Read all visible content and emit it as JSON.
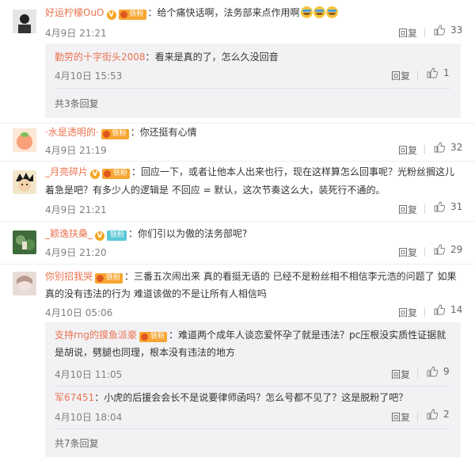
{
  "ui": {
    "reply_label": "回复",
    "colors": {
      "username": "#eb7350",
      "meta": "#808080",
      "sub_bg": "#f2f2f5"
    }
  },
  "comments": [
    {
      "user": "好运柠檬OuO",
      "verified": true,
      "fan_badge": "铁粉",
      "text": "给个痛快话啊，法务部来点作用啊",
      "emoji": [
        "crying-face",
        "crying-face",
        "crying-face"
      ],
      "time": "4月9日 21:21",
      "likes": "33",
      "replies": [
        {
          "user": "勤劳的十字街头2008",
          "text": "看来是真的了，怎么久没回音",
          "time": "4月10日 15:53",
          "likes": "1"
        }
      ],
      "more": "共3条回复"
    },
    {
      "user": "·水是透明的·",
      "verified": false,
      "fan_badge": "铁粉",
      "text": "你还挺有心情",
      "time": "4月9日 21:19",
      "likes": "32"
    },
    {
      "user": "_月亮碎片",
      "verified": true,
      "fan_badge": "铁粉",
      "text_lines": [
        "回应一下，或者让他本人出来也行，现在这样算怎么回事呢？光粉丝搁这儿",
        "着急是吧？有多少人的逻辑是 不回应 = 默认，这次节奏这么大，装死行不通的。"
      ],
      "time": "4月9日 21:21",
      "likes": "31"
    },
    {
      "user": "_颖逸扶桑_",
      "verified": true,
      "fan_badge": "铁粉",
      "text": "你们引以为傲的法务部呢?",
      "time": "4月9日 21:20",
      "likes": "29"
    },
    {
      "user": "你别招我哭",
      "verified": false,
      "fan_badge": "铁粉",
      "text_lines": [
        "三番五次闹出来 真的看挺无语的 已经不是粉丝相不相信李元浩的问题了 如果",
        "真的没有违法的行为 难道该做的不是让所有人相信吗"
      ],
      "time": "4月10日 05:06",
      "likes": "14",
      "replies": [
        {
          "user": "支持rng的摸鱼派豪",
          "fan_badge": "铁粉",
          "text_lines": [
            "难道两个成年人谈恋爱怀孕了就是违法？pc压根没实质性证据就",
            "是胡说，劈腿也同理，根本没有违法的地方"
          ],
          "time": "4月10日 11:05",
          "likes": "9"
        },
        {
          "user": "军67451",
          "text": "小虎的后援会会长不是说要律师函吗？怎么号都不见了？这是脱粉了吧？",
          "time": "4月10日 18:04",
          "likes": "2"
        }
      ],
      "more": "共7条回复"
    }
  ]
}
